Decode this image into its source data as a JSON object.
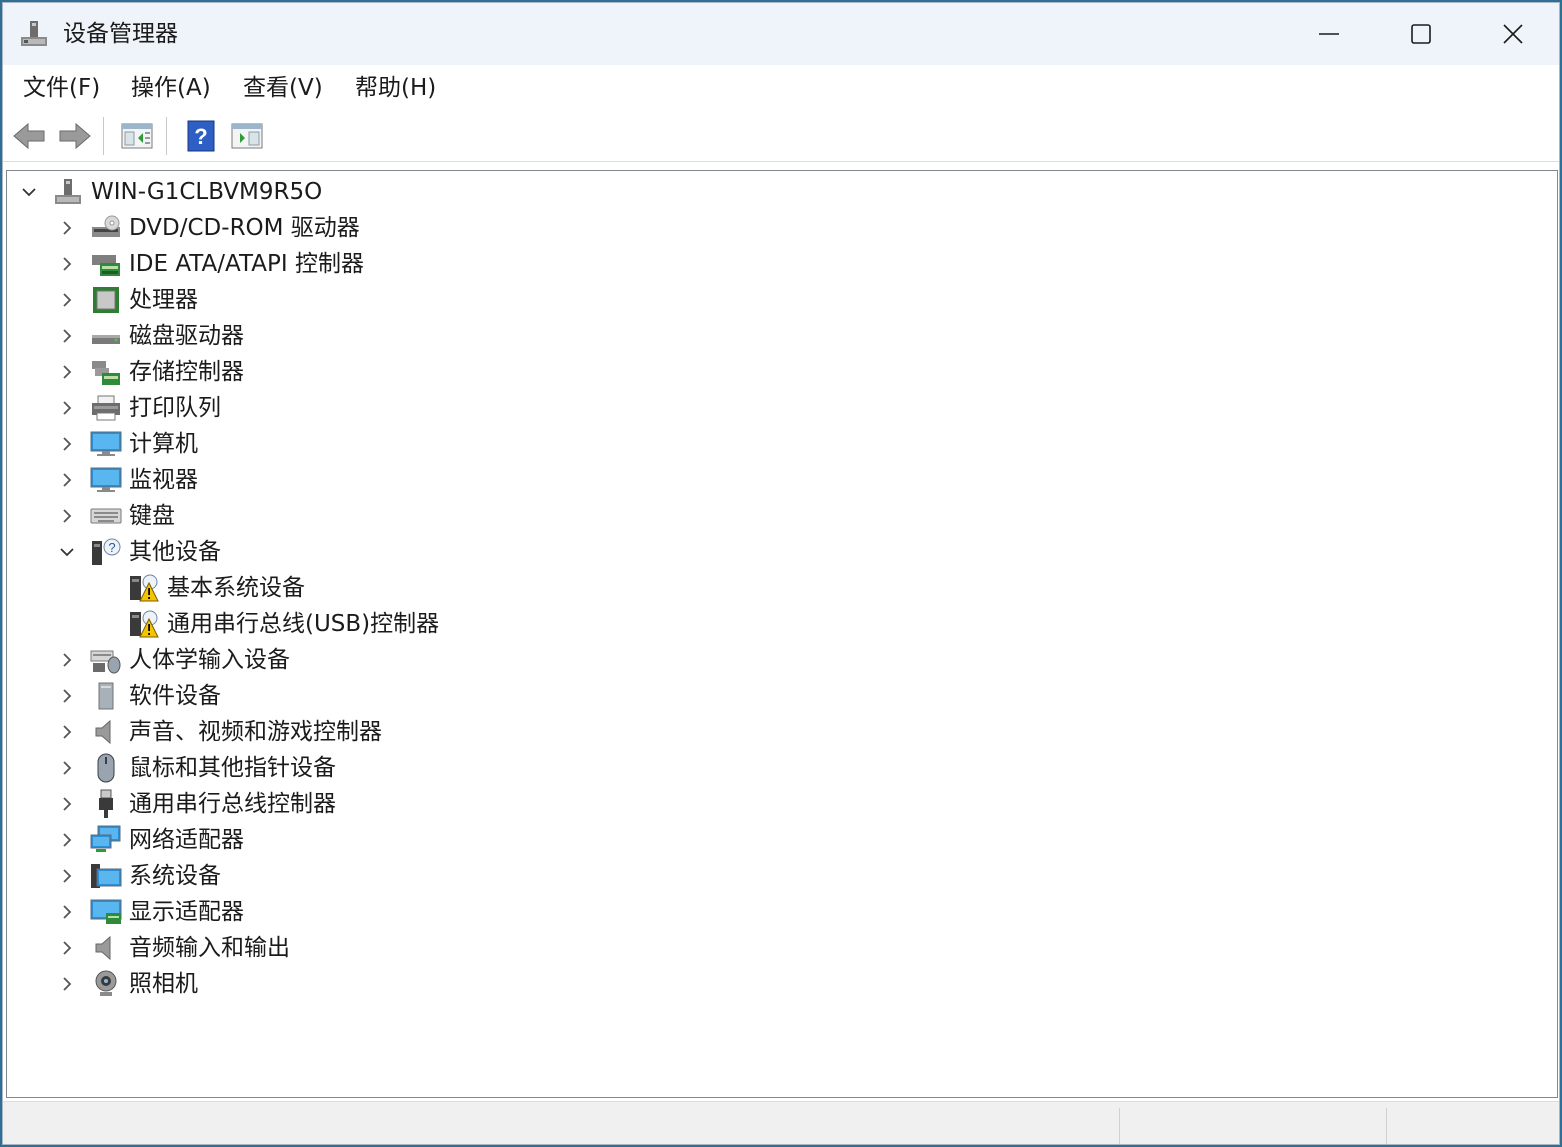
{
  "window": {
    "title": "设备管理器"
  },
  "menu": {
    "items": [
      {
        "label": "文件(F)"
      },
      {
        "label": "操作(A)"
      },
      {
        "label": "查看(V)"
      },
      {
        "label": "帮助(H)"
      }
    ]
  },
  "toolbar": {
    "buttons": [
      {
        "icon": "back-arrow-icon"
      },
      {
        "icon": "forward-arrow-icon"
      },
      {
        "icon": "show-hide-console-tree-icon"
      },
      {
        "icon": "help-icon"
      },
      {
        "icon": "show-hide-action-pane-icon"
      }
    ]
  },
  "tree": {
    "root": {
      "label": "WIN-G1CLBVM9R5O",
      "expanded": true,
      "icon": "computer-tree-icon"
    },
    "categories": [
      {
        "label": "DVD/CD-ROM 驱动器",
        "icon": "dvd-drive-icon",
        "expanded": false
      },
      {
        "label": "IDE ATA/ATAPI 控制器",
        "icon": "ide-controller-icon",
        "expanded": false
      },
      {
        "label": "处理器",
        "icon": "processor-icon",
        "expanded": false
      },
      {
        "label": "磁盘驱动器",
        "icon": "disk-drive-icon",
        "expanded": false
      },
      {
        "label": "存储控制器",
        "icon": "storage-controller-icon",
        "expanded": false
      },
      {
        "label": "打印队列",
        "icon": "printer-icon",
        "expanded": false
      },
      {
        "label": "计算机",
        "icon": "computer-icon",
        "expanded": false
      },
      {
        "label": "监视器",
        "icon": "monitor-icon",
        "expanded": false
      },
      {
        "label": "键盘",
        "icon": "keyboard-icon",
        "expanded": false
      },
      {
        "label": "其他设备",
        "icon": "other-devices-icon",
        "expanded": true,
        "children": [
          {
            "label": "基本系统设备",
            "icon": "warning-device-icon"
          },
          {
            "label": "通用串行总线(USB)控制器",
            "icon": "warning-device-icon"
          }
        ]
      },
      {
        "label": "人体学输入设备",
        "icon": "hid-icon",
        "expanded": false
      },
      {
        "label": "软件设备",
        "icon": "software-device-icon",
        "expanded": false
      },
      {
        "label": "声音、视频和游戏控制器",
        "icon": "speaker-icon",
        "expanded": false
      },
      {
        "label": "鼠标和其他指针设备",
        "icon": "mouse-icon",
        "expanded": false
      },
      {
        "label": "通用串行总线控制器",
        "icon": "usb-icon",
        "expanded": false
      },
      {
        "label": "网络适配器",
        "icon": "network-adapter-icon",
        "expanded": false
      },
      {
        "label": "系统设备",
        "icon": "system-devices-icon",
        "expanded": false
      },
      {
        "label": "显示适配器",
        "icon": "display-adapter-icon",
        "expanded": false
      },
      {
        "label": "音频输入和输出",
        "icon": "audio-io-icon",
        "expanded": false
      },
      {
        "label": "照相机",
        "icon": "camera-icon",
        "expanded": false
      }
    ]
  },
  "colors": {
    "titlebar_bg": "#eef4f9",
    "warning": "#f5c400",
    "monitor_blue": "#2a8fd6"
  }
}
